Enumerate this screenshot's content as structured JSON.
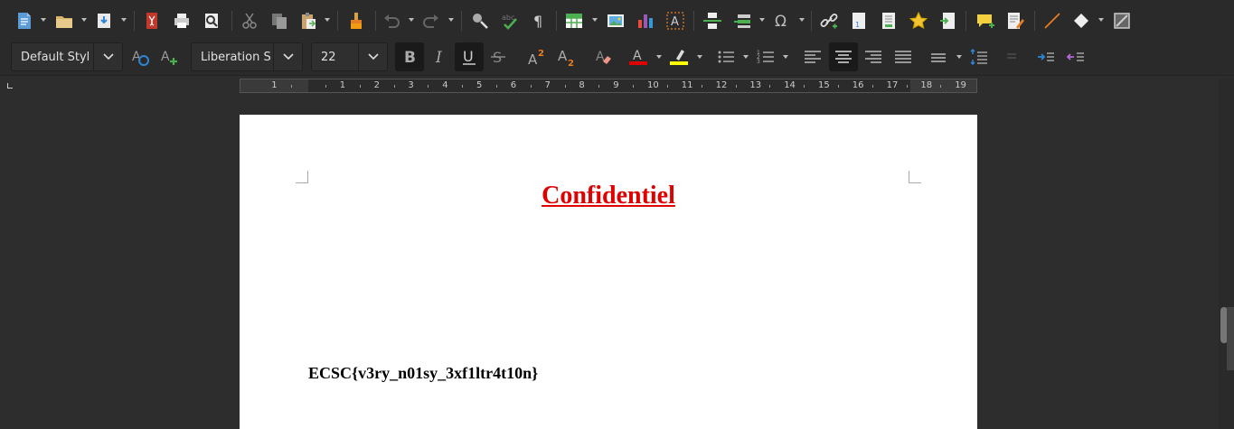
{
  "toolbar": {
    "new_label": "New",
    "open_label": "Open",
    "save_label": "Save",
    "export_pdf_label": "Export as PDF",
    "print_label": "Print",
    "print_preview_label": "Toggle Print Preview",
    "cut_label": "Cut",
    "copy_label": "Copy",
    "paste_label": "Paste",
    "clone_label": "Clone Formatting",
    "undo_label": "Undo",
    "redo_label": "Redo",
    "find_replace_label": "Find & Replace",
    "spelling_label": "Spelling",
    "formatting_marks_label": "Formatting Marks",
    "insert_table_label": "Insert Table",
    "insert_image_label": "Insert Image",
    "insert_chart_label": "Insert Chart",
    "insert_textbox_label": "Insert Text Box",
    "insert_page_break_label": "Insert Page Break",
    "insert_field_label": "Insert Field",
    "special_char_label": "Insert Special Character",
    "hyperlink_label": "Insert Hyperlink",
    "footnote_label": "Insert Footnote",
    "endnote_label": "Insert Endnote",
    "bookmark_label": "Insert Bookmark",
    "cross_reference_label": "Insert Cross-reference",
    "comment_label": "Insert Comment",
    "track_changes_label": "Track Changes",
    "line_label": "Insert Line",
    "basic_shapes_label": "Basic Shapes",
    "draw_functions_label": "Show Draw Functions"
  },
  "formatting": {
    "paragraph_style": "Default Styl",
    "font_name": "Liberation S",
    "font_size": "22"
  },
  "ruler": {
    "numbers": [
      "1",
      "1",
      "2",
      "3",
      "4",
      "5",
      "6",
      "7",
      "8",
      "9",
      "10",
      "11",
      "12",
      "13",
      "14",
      "15",
      "16",
      "17",
      "18",
      "19"
    ]
  },
  "document": {
    "title": "Confidentiel",
    "body": "ECSC{v3ry_n01sy_3xf1ltr4t10n}"
  },
  "colors": {
    "title_color": "#e00000",
    "font_color_bar": "#e00000",
    "highlight_bar": "#ffff00",
    "page_background": "#ffffff",
    "ui_background": "#2d2d2d"
  }
}
